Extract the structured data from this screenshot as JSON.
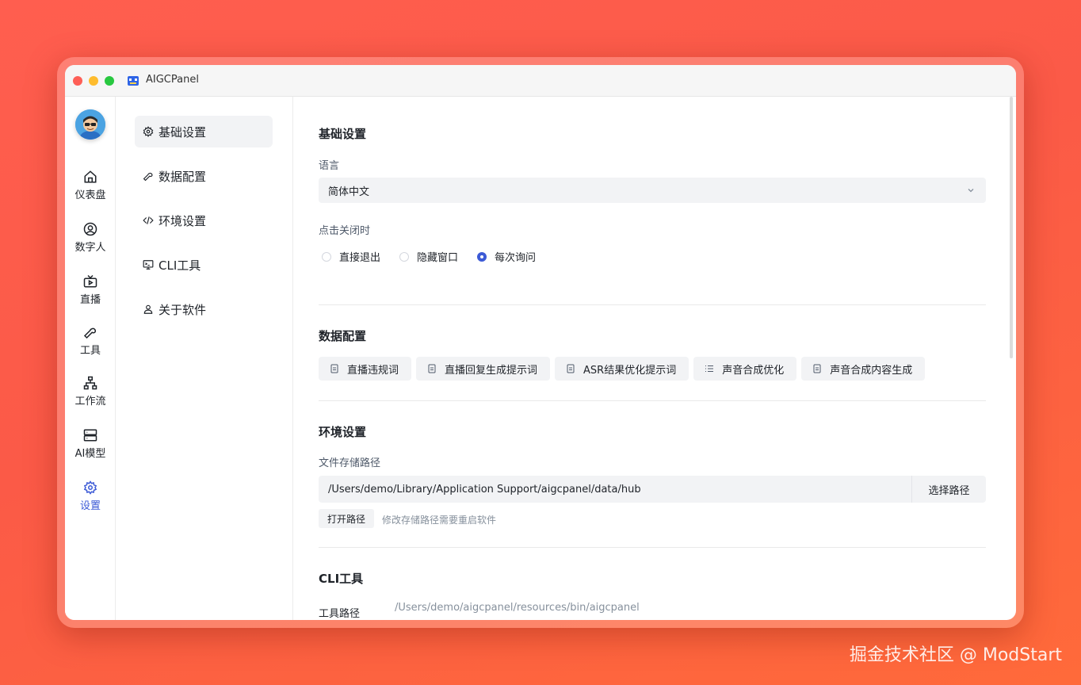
{
  "window": {
    "title": "AIGCPanel"
  },
  "nav": {
    "items": [
      {
        "label": "仪表盘",
        "icon": "home-icon"
      },
      {
        "label": "数字人",
        "icon": "user-circle-icon"
      },
      {
        "label": "直播",
        "icon": "tv-icon"
      },
      {
        "label": "工具",
        "icon": "wrench-icon"
      },
      {
        "label": "工作流",
        "icon": "workflow-icon"
      },
      {
        "label": "AI模型",
        "icon": "server-icon"
      },
      {
        "label": "设置",
        "icon": "gear-icon",
        "active": true
      }
    ]
  },
  "submenu": {
    "items": [
      {
        "label": "基础设置",
        "icon": "gear-icon",
        "active": true
      },
      {
        "label": "数据配置",
        "icon": "wrench-icon"
      },
      {
        "label": "环境设置",
        "icon": "code-icon"
      },
      {
        "label": "CLI工具",
        "icon": "terminal-icon"
      },
      {
        "label": "关于软件",
        "icon": "user-icon"
      }
    ]
  },
  "basic": {
    "title": "基础设置",
    "language_label": "语言",
    "language_value": "简体中文",
    "close_label": "点击关闭时",
    "close_options": [
      {
        "label": "直接退出",
        "checked": false
      },
      {
        "label": "隐藏窗口",
        "checked": false
      },
      {
        "label": "每次询问",
        "checked": true
      }
    ]
  },
  "data_config": {
    "title": "数据配置",
    "buttons": [
      {
        "label": "直播违规词",
        "icon": "document-icon"
      },
      {
        "label": "直播回复生成提示词",
        "icon": "document-icon"
      },
      {
        "label": "ASR结果优化提示词",
        "icon": "document-icon"
      },
      {
        "label": "声音合成优化",
        "icon": "list-icon"
      },
      {
        "label": "声音合成内容生成",
        "icon": "document-icon"
      }
    ]
  },
  "env": {
    "title": "环境设置",
    "storage_label": "文件存储路径",
    "storage_path": "/Users/demo/Library/Application Support/aigcpanel/data/hub",
    "choose_path": "选择路径",
    "open_path": "打开路径",
    "hint": "修改存储路径需要重启软件"
  },
  "cli": {
    "title": "CLI工具",
    "path_label": "工具路径",
    "path_value": "/Users/demo/aigcpanel/resources/bin/aigcpanel"
  },
  "watermark": "掘金技术社区 @ ModStart",
  "colors": {
    "accent": "#3c5ad6",
    "background": "#fb5a47"
  }
}
